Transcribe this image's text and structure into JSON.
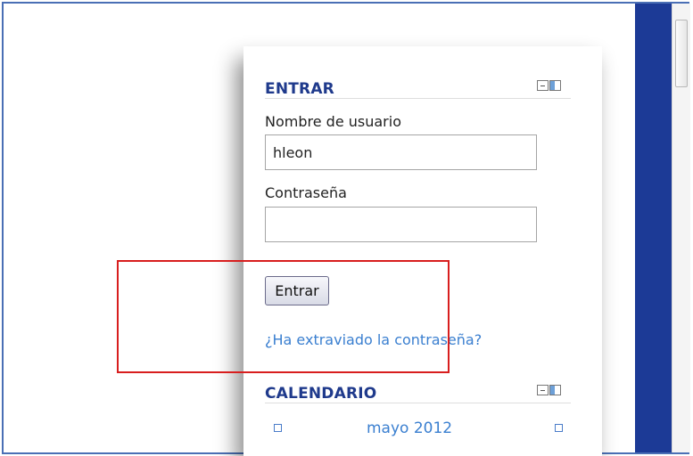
{
  "login_block": {
    "title": "ENTRAR",
    "username_label": "Nombre de usuario",
    "username_value": "hleon",
    "password_label": "Contraseña",
    "password_value": "",
    "submit_label": "Entrar",
    "forgot_link": "¿Ha extraviado la contraseña?"
  },
  "calendar_block": {
    "title": "CALENDARIO",
    "month": "mayo 2012"
  },
  "colors": {
    "header_blue": "#1f3a8c",
    "link_blue": "#3a7fd0",
    "side_bar_blue": "#1c3a96",
    "highlight_red": "#d81e1e"
  },
  "icons": [
    "minimize-icon",
    "dock-icon",
    "prev-month-icon",
    "next-month-icon"
  ]
}
